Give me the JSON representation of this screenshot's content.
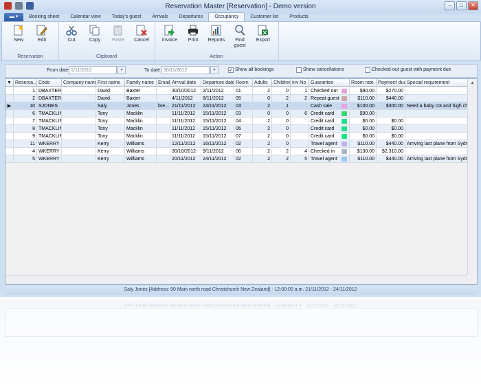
{
  "window": {
    "title": "Reservation Master [Reservation] - Demo version"
  },
  "tabs": [
    "Booking sheet",
    "Calendar view",
    "Today's guest",
    "Arrivals",
    "Departures",
    "Occupancy",
    "Customer list",
    "Products"
  ],
  "active_tab": "Occupancy",
  "ribbon": {
    "groups": [
      {
        "label": "Reservation",
        "buttons": [
          "New",
          "Edit"
        ]
      },
      {
        "label": "Clipboard",
        "buttons": [
          "Cut",
          "Copy",
          "Paste",
          "Cancel"
        ]
      },
      {
        "label": "Action",
        "buttons": [
          "Invoice",
          "Print",
          "Reports",
          "Find guest",
          "Export"
        ]
      }
    ]
  },
  "filter": {
    "from_label": "From date",
    "from_value": "1/11/2012",
    "to_label": "To date",
    "to_value": "30/11/2012",
    "show_all": "Show all bookings",
    "show_cancellations": "Show cancellations",
    "checked_out": "Checked-out guest with payment due"
  },
  "table": {
    "columns": [
      "Reserva...",
      "Code",
      "Company name",
      "First name",
      "Family name",
      "Email",
      "Arrival date",
      "Departure date",
      "Room",
      "Adults",
      "Children",
      "Inv No",
      "Guarantee",
      "Room rate",
      "Payment due",
      "Special requirement"
    ],
    "rows": [
      [
        "1",
        "DBAXTER",
        "",
        "David",
        "Baxter",
        "",
        "30/10/2012",
        "2/11/2012",
        "01",
        "2",
        "0",
        "1",
        "Checked out",
        "$90.00",
        "$270.00",
        ""
      ],
      [
        "2",
        "DBAXTER",
        "",
        "David",
        "Baxter",
        "",
        "4/11/2012",
        "8/11/2012",
        "05",
        "0",
        "2",
        "2",
        "Repeat guest",
        "$110.00",
        "$440.00",
        ""
      ],
      [
        "10",
        "SJONES",
        "",
        "Saly",
        "Jones",
        "bre...",
        "21/11/2012",
        "24/11/2012",
        "03",
        "2",
        "1",
        "",
        "Cash sale",
        "$100.00",
        "$300.00",
        "Need a baby cot and high chair"
      ],
      [
        "6",
        "TMACKLIN",
        "",
        "Tony",
        "Macklin",
        "",
        "11/11/2012",
        "15/11/2012",
        "03",
        "0",
        "0",
        "6",
        "Credit card",
        "$90.00",
        "",
        ""
      ],
      [
        "7",
        "TMACKLIN",
        "",
        "Tony",
        "Macklin",
        "",
        "11/11/2012",
        "15/11/2012",
        "04",
        "2",
        "0",
        "",
        "Credit card",
        "$0.00",
        "$0.00",
        ""
      ],
      [
        "8",
        "TMACKLIN",
        "",
        "Tony",
        "Macklin",
        "",
        "11/11/2012",
        "15/11/2012",
        "06",
        "2",
        "0",
        "",
        "Credit card",
        "$0.00",
        "$0.00",
        ""
      ],
      [
        "9",
        "TMACKLIN",
        "",
        "Tony",
        "Macklin",
        "",
        "11/11/2012",
        "15/11/2012",
        "07",
        "2",
        "0",
        "",
        "Credit card",
        "$0.00",
        "$0.00",
        ""
      ],
      [
        "11",
        "WKERRY",
        "",
        "Kerry",
        "Williams",
        "",
        "12/11/2012",
        "16/11/2012",
        "02",
        "2",
        "0",
        "",
        "Travel agent",
        "$110.00",
        "$440.00",
        "Arriving last plane from Sydney"
      ],
      [
        "4",
        "WKERRY",
        "",
        "Kerry",
        "Williams",
        "",
        "30/10/2012",
        "9/11/2012",
        "06",
        "2",
        "2",
        "4",
        "Checked in",
        "$130.00",
        "$2,310.00",
        ""
      ],
      [
        "5",
        "WKERRY",
        "",
        "Kerry",
        "Williams",
        "",
        "20/11/2012",
        "24/11/2012",
        "02",
        "2",
        "2",
        "5",
        "Travel agent",
        "$110.00",
        "$440.00",
        "Arriving last plane from Sydney"
      ]
    ],
    "swatches": [
      "#e2a3d6",
      "#c9a6a8",
      "#e4a3e1",
      "#39d46f",
      "#1fe08c",
      "#1fe08c",
      "#1fe08c",
      "#b9b3e6",
      "#aab7c9",
      "#9ec4e8"
    ],
    "selected_row": 2
  },
  "status": "Saly Jones [Address: 90 Main north road Christchurch New Zealand] - 12:00:00 a.m. 21/11/2012 - 24/11/2012"
}
